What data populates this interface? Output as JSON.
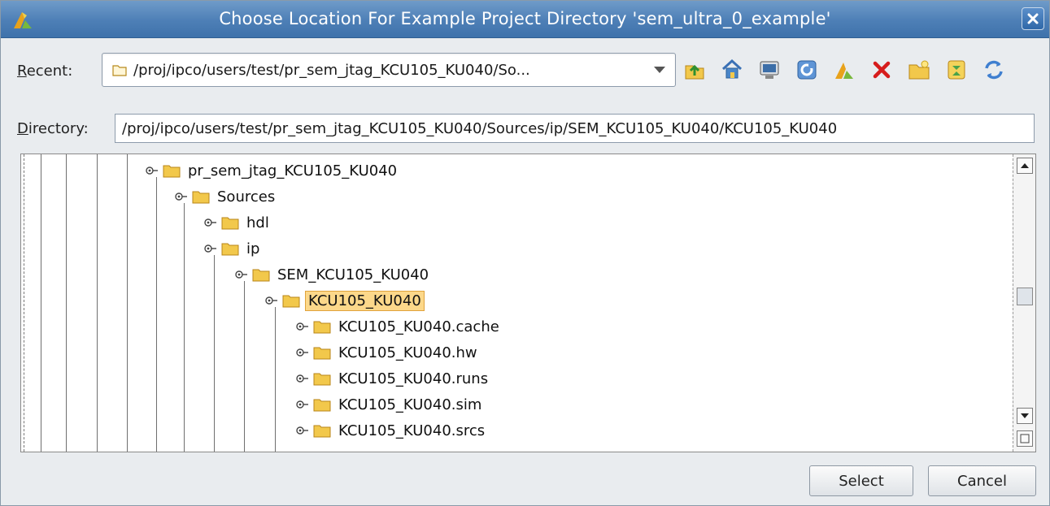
{
  "window": {
    "title": "Choose Location For Example Project Directory 'sem_ultra_0_example'"
  },
  "recent": {
    "label": "Recent:",
    "value": "/proj/ipco/users/test/pr_sem_jtag_KCU105_KU040/So..."
  },
  "toolbar": {
    "icons": [
      "up-folder-icon",
      "home-icon",
      "desktop-icon",
      "refresh-location-icon",
      "project-icon",
      "delete-icon",
      "new-folder-icon",
      "collapse-icon",
      "sync-icon"
    ]
  },
  "directory": {
    "label": "Directory:",
    "value": "/proj/ipco/users/test/pr_sem_jtag_KCU105_KU040/Sources/ip/SEM_KCU105_KU040/KCU105_KU040"
  },
  "tree": {
    "nodes": [
      {
        "label": "pr_sem_jtag_KCU105_KU040",
        "depth": 0,
        "selected": false
      },
      {
        "label": "Sources",
        "depth": 1,
        "selected": false
      },
      {
        "label": "hdl",
        "depth": 2,
        "selected": false
      },
      {
        "label": "ip",
        "depth": 2,
        "selected": false
      },
      {
        "label": "SEM_KCU105_KU040",
        "depth": 3,
        "selected": false
      },
      {
        "label": "KCU105_KU040",
        "depth": 4,
        "selected": true
      },
      {
        "label": "KCU105_KU040.cache",
        "depth": 5,
        "selected": false
      },
      {
        "label": "KCU105_KU040.hw",
        "depth": 5,
        "selected": false
      },
      {
        "label": "KCU105_KU040.runs",
        "depth": 5,
        "selected": false
      },
      {
        "label": "KCU105_KU040.sim",
        "depth": 5,
        "selected": false
      },
      {
        "label": "KCU105_KU040.srcs",
        "depth": 5,
        "selected": false
      }
    ]
  },
  "buttons": {
    "select": "Select",
    "cancel": "Cancel"
  },
  "colors": {
    "titlebar": "#4d7fb6",
    "selection": "#fcd88a",
    "folder": "#f2c84b"
  }
}
